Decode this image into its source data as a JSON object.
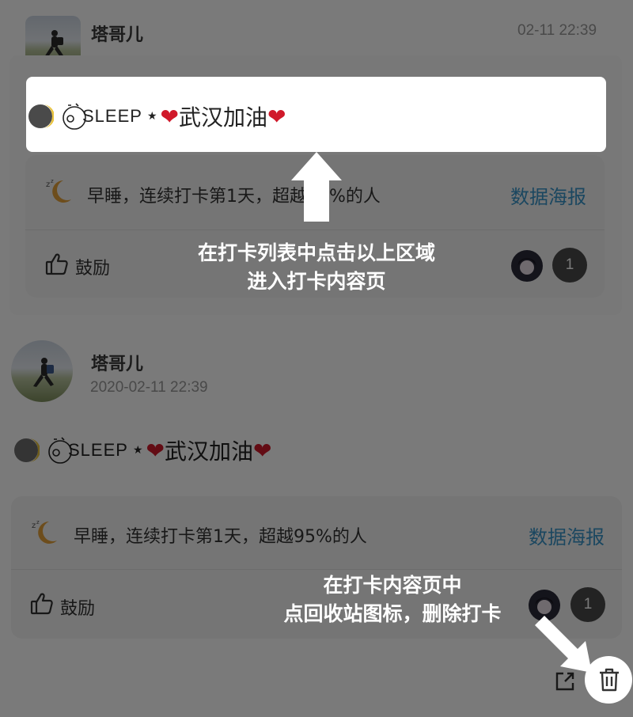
{
  "post_list_item": {
    "username": "塔哥儿",
    "time": "02-11 22:39",
    "content_prefix": "SLEEP",
    "content_text": "武汉加油",
    "stats_text": "早睡，连续打卡第1天，超越95%的人",
    "poster_link": "数据海报",
    "encourage_label": "鼓励",
    "encourage_count": "1"
  },
  "post_detail": {
    "username": "塔哥儿",
    "datetime": "2020-02-11 22:39",
    "content_prefix": "SLEEP",
    "content_text": "武汉加油",
    "stats_text": "早睡，连续打卡第1天，超越95%的人",
    "poster_link": "数据海报",
    "encourage_label": "鼓励",
    "encourage_count": "1"
  },
  "tips": {
    "tip1_line1": "在打卡列表中点击以上区域",
    "tip1_line2": "进入打卡内容页",
    "tip2_line1": "在打卡内容页中",
    "tip2_line2": "点回收站图标，删除打卡"
  },
  "icons": {
    "moon": "moon-icon",
    "sleep_face": "sleep-face-icon",
    "heart": "heart-icon",
    "zz_moon": "sleep-moon-icon",
    "thumbs_up": "thumbs-up-icon",
    "share": "share-icon",
    "trash": "trash-icon"
  },
  "colors": {
    "link": "#3a95c9",
    "heart": "#d0192a",
    "overlay": "rgba(0,0,0,0.52)",
    "badge": "#4a4a4a"
  }
}
